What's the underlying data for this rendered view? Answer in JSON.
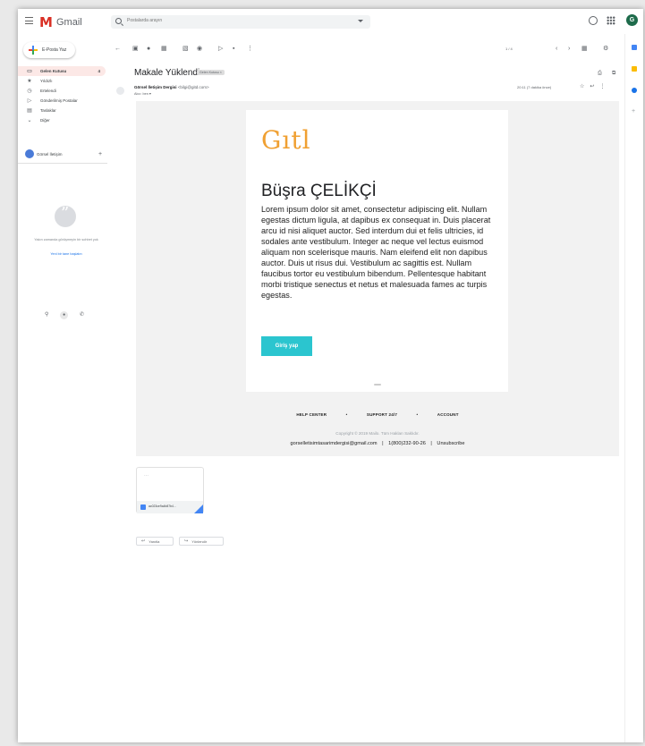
{
  "topbar": {
    "app_name": "Gmail",
    "search_placeholder": "Postalarda arayın",
    "avatar_letter": "G"
  },
  "sidebar": {
    "compose_label": "E-Posta Yaz",
    "items": [
      {
        "icon": "▭",
        "label": "Gelen Kutusu",
        "count": "4",
        "active": true
      },
      {
        "icon": "★",
        "label": "Yıldızlı"
      },
      {
        "icon": "◷",
        "label": "Ertelendi"
      },
      {
        "icon": "▷",
        "label": "Gönderilmiş Postalar"
      },
      {
        "icon": "▤",
        "label": "Taslaklar"
      },
      {
        "icon": "⌄",
        "label": "Diğer"
      }
    ],
    "hangouts_user": "Görsel İletişim",
    "hangouts_empty_msg": "Yakın zamanda görüşmeyin bir sohbet yok",
    "hangouts_link": "Yeni bir tane başlatın"
  },
  "toolbar": {
    "glyphs": [
      "←",
      "▣",
      "●",
      "▦",
      "▧",
      "◉",
      "▷",
      "▪",
      "⋮"
    ],
    "pagination": "1 / 4",
    "right_icons": [
      "‹",
      "›",
      "▦",
      "⚙"
    ]
  },
  "message": {
    "subject": "Makale Yüklendi",
    "label": "Gelen Kutusu ×",
    "sender_name": "Görsel İletişim Dergisi",
    "sender_email": "<bilgi@gitd.com>",
    "to": "Alıcı: ben ▾",
    "date": "20:11 (7 dakika önce)"
  },
  "email": {
    "brand_logo": "Gıtl",
    "recipient_name": "Büşra ÇELİKÇİ",
    "body": "Lorem ipsum dolor sit amet, consectetur adipiscing elit. Nullam egestas dictum ligula, at dapibus ex consequat in. Duis placerat arcu id nisi aliquet auctor. Sed interdum dui et felis ultricies, id sodales ante vestibulum. Integer ac neque vel lectus euismod aliquam non scelerisque mauris. Nam eleifend elit non dapibus auctor. Duis ut risus dui. Vestibulum ac sagittis est. Nullam faucibus tortor eu vestibulum bibendum. Pellentesque habitant morbi tristique senectus et netus et malesuada fames ac turpis egestas.",
    "cta_label": "Giriş yap",
    "footer_links": [
      "HELP CENTER",
      "•",
      "SUPPORT 24/7",
      "•",
      "ACCOUNT"
    ],
    "copyright": "Copyright © 2019 Mailo. Tüm Hakları Saklıdır.",
    "contact_email": "gorselletisimtasarimdergisi@gmail.com",
    "separator": "|",
    "phone": "1(800)232-90-26",
    "unsubscribe": "Unsubscribe"
  },
  "attachment": {
    "filename": "ac023ce9a4b87b4..."
  },
  "actions": {
    "reply": "Yanıtla",
    "forward": "Yönlendir"
  },
  "colors": {
    "brand_orange": "#f0a032",
    "cta_teal": "#2bc5cf",
    "gmail_red": "#d93025"
  }
}
